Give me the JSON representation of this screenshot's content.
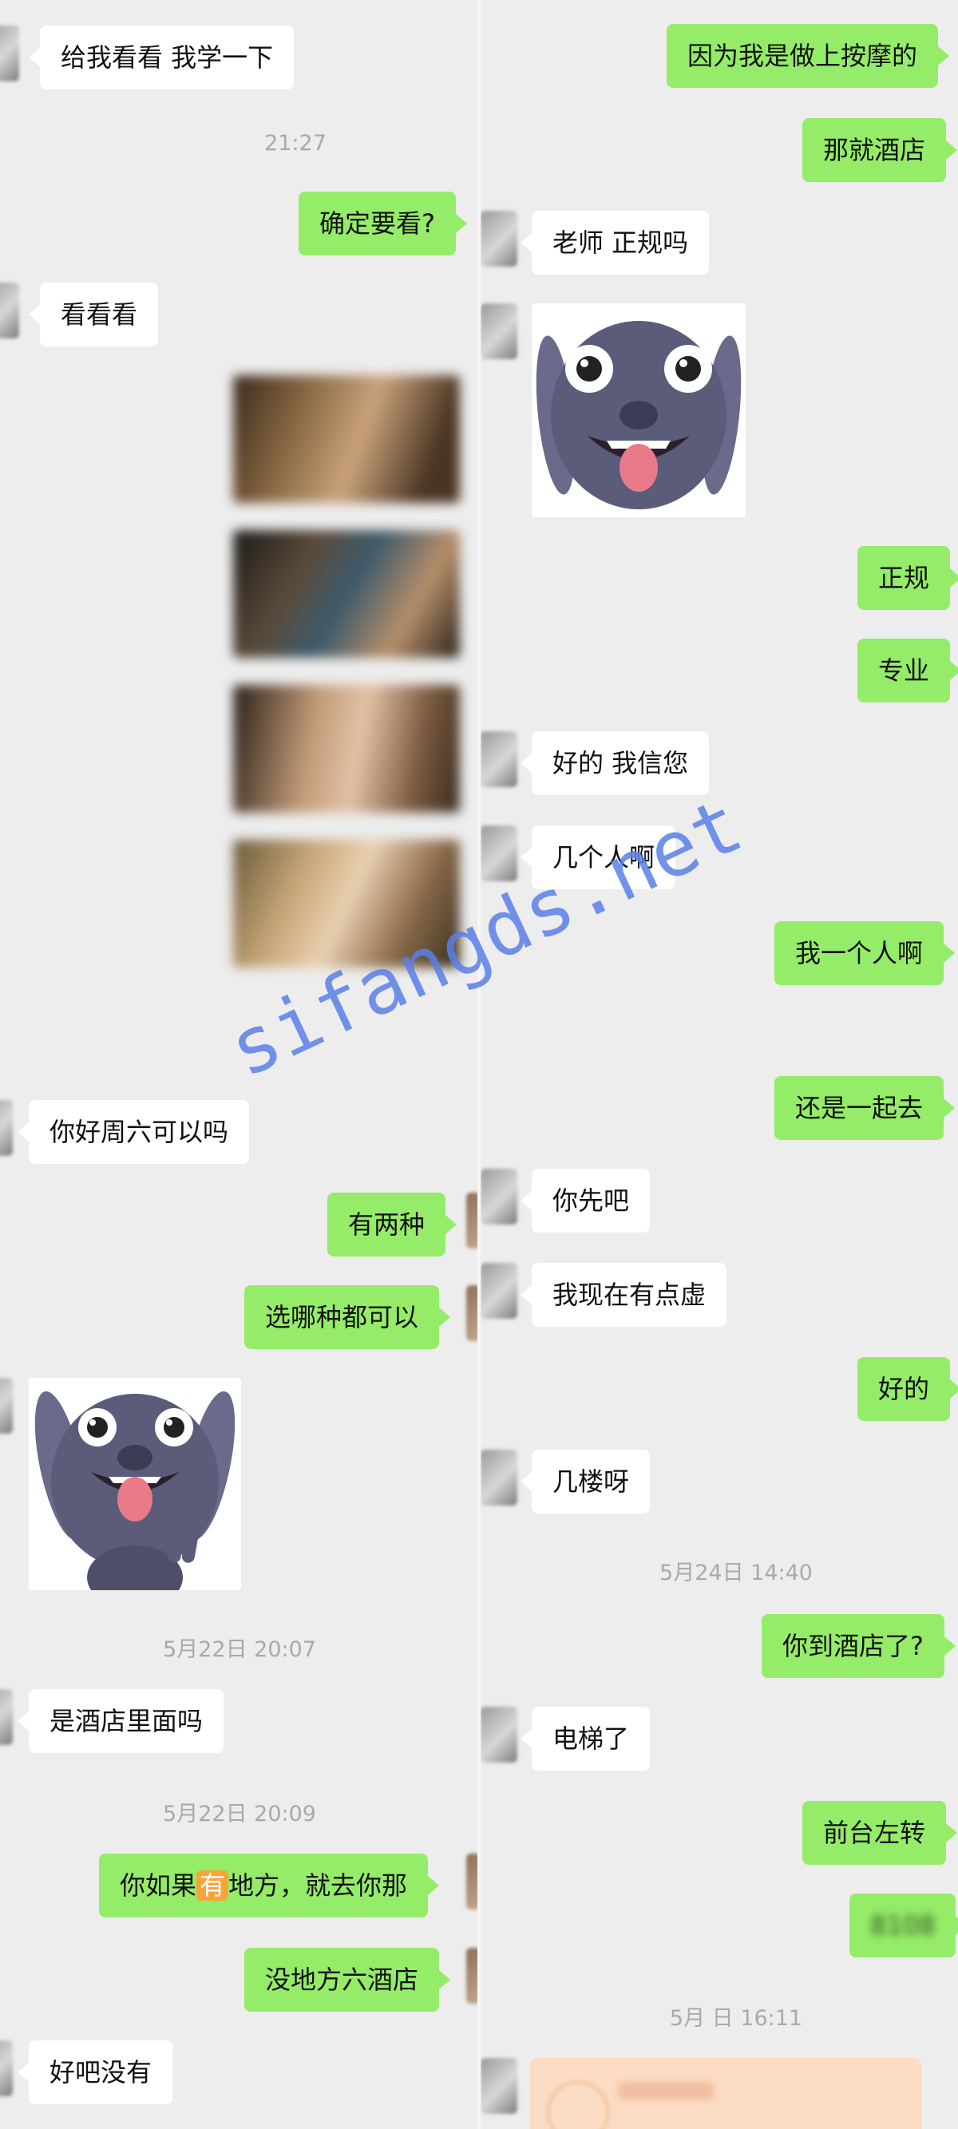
{
  "left_column": {
    "messages": {
      "m1": "给我看看 我学一下",
      "m2": "确定要看?",
      "m3": "看看看",
      "m4": "你好周六可以吗",
      "m5": "有两种",
      "m6": "选哪种都可以",
      "m7": "是酒店里面吗",
      "m8_before": "你如果",
      "m8_highlight": "有",
      "m8_after": "地方，就去你那",
      "m9": "没地方六酒店",
      "m10": "好吧没有"
    },
    "timestamps": {
      "t1": "21:27",
      "t2": "5月22日 20:07",
      "t3": "5月22日 20:09"
    }
  },
  "right_column": {
    "messages": {
      "r1": "因为我是做上按摩的",
      "r2": "那就酒店",
      "r3": "老师 正规吗",
      "r4": "正规",
      "r5": "专业",
      "r6": "好的 我信您",
      "r7": "几个人啊",
      "r8": "我一个人啊",
      "r9": "还是一起去",
      "r10": "你先吧",
      "r11": "我现在有点虚",
      "r12": "好的",
      "r13": "几楼呀",
      "r14": "你到酒店了?",
      "r15": "电梯了",
      "r16": "前台左转",
      "r17": "8108"
    },
    "timestamps": {
      "t1": "5月24日 14:40",
      "t2": "5月 日 16:11"
    }
  },
  "watermark": "sifangds.net",
  "colors": {
    "background": "#ededed",
    "incoming_bubble": "#ffffff",
    "outgoing_bubble": "#95ec69",
    "timestamp_text": "#a9a9a9",
    "watermark": "#5a7fe8"
  }
}
